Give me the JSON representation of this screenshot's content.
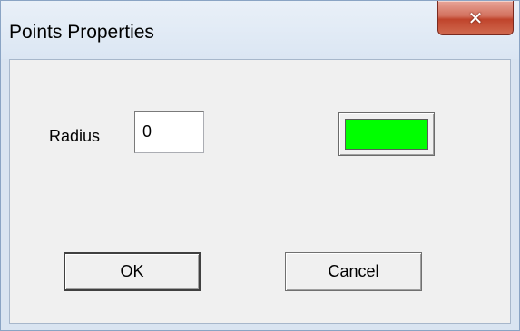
{
  "window": {
    "title": "Points Properties",
    "close_icon": "close-icon",
    "close_glyph": "✕"
  },
  "form": {
    "radius_label": "Radius",
    "radius_value": "0",
    "color_swatch": "#00ff00"
  },
  "buttons": {
    "ok_label": "OK",
    "cancel_label": "Cancel"
  },
  "colors": {
    "close_button": "#c0442c",
    "dialog_background": "#f0f0f0",
    "frame": "#d9e4f1"
  }
}
